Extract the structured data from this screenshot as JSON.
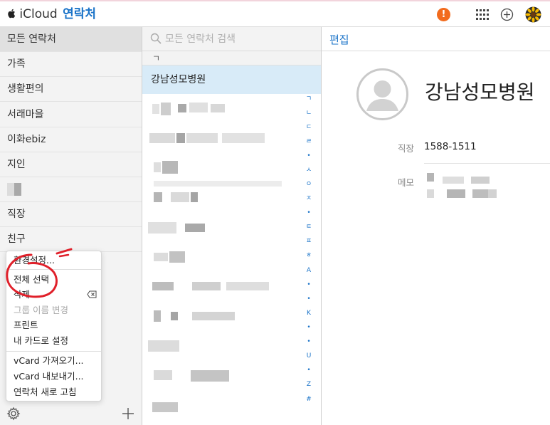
{
  "header": {
    "brand": "iCloud",
    "app_name": "연락처",
    "alert_badge": "!",
    "icons": [
      "apple-logo-icon",
      "alert-icon",
      "app-grid-icon",
      "add-circle-icon",
      "avatar-icon"
    ]
  },
  "sidebar": {
    "groups": [
      {
        "label": "모든 연락처",
        "selected": true
      },
      {
        "label": "가족"
      },
      {
        "label": "생활편의"
      },
      {
        "label": "서래마을"
      },
      {
        "label": "이화ebiz"
      },
      {
        "label": "지인"
      },
      {
        "label": ""
      },
      {
        "label": "직장"
      },
      {
        "label": "친구"
      }
    ],
    "menu": {
      "items": [
        {
          "label": "환경설정..."
        },
        {
          "label": "전체 선택"
        },
        {
          "label": "삭제"
        },
        {
          "label": "그룹 이름 변경",
          "disabled": true
        },
        {
          "label": "프린트"
        },
        {
          "label": "내 카드로 설정"
        },
        {
          "label": "vCard 가져오기..."
        },
        {
          "label": "vCard 내보내기..."
        },
        {
          "label": "연락처 새로 고침"
        }
      ]
    }
  },
  "list": {
    "search_placeholder": "모든 연락처 검색",
    "section_header": "ㄱ",
    "selected_contact": "강남성모병원",
    "index_letters": [
      "ㄱ",
      "ㄴ",
      "ㄷ",
      "ㄹ",
      "•",
      "ㅅ",
      "ㅇ",
      "ㅈ",
      "•",
      "ㅌ",
      "ㅍ",
      "ㅎ",
      "A",
      "•",
      "•",
      "K",
      "•",
      "•",
      "U",
      "•",
      "Z",
      "#"
    ]
  },
  "detail": {
    "edit_label": "편집",
    "name": "강남성모병원",
    "fields": [
      {
        "label": "직장",
        "value": "1588-1511"
      },
      {
        "label": "메모",
        "value": ""
      }
    ]
  },
  "colors": {
    "accent": "#1a73c8",
    "alert": "#f26b1d",
    "selection": "#d8ebf8",
    "annotation": "#e0202a"
  }
}
